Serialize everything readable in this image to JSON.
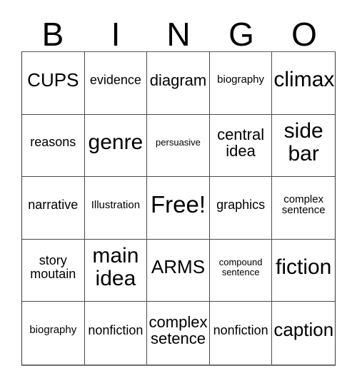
{
  "card": {
    "title": "BINGO",
    "header_letters": [
      "B",
      "I",
      "N",
      "G",
      "O"
    ],
    "columns": 5,
    "rows": 5,
    "colors": {
      "text": "#000000",
      "grid_line": "#4a4a4a",
      "background": "#ffffff"
    },
    "cells": [
      {
        "text": "CUPS",
        "size": "lg",
        "column": "B",
        "row": 1,
        "free": false
      },
      {
        "text": "evidence",
        "size": "sm",
        "column": "I",
        "row": 1,
        "free": false
      },
      {
        "text": "diagram",
        "size": "md",
        "column": "N",
        "row": 1,
        "free": false
      },
      {
        "text": "biography",
        "size": "xs",
        "column": "G",
        "row": 1,
        "free": false
      },
      {
        "text": "climax",
        "size": "xl",
        "column": "O",
        "row": 1,
        "free": false
      },
      {
        "text": "reasons",
        "size": "sm",
        "column": "B",
        "row": 2,
        "free": false
      },
      {
        "text": "genre",
        "size": "xl",
        "column": "I",
        "row": 2,
        "free": false
      },
      {
        "text": "persuasive",
        "size": "xxs",
        "column": "N",
        "row": 2,
        "free": false
      },
      {
        "text": "central\nidea",
        "size": "md",
        "column": "G",
        "row": 2,
        "free": false
      },
      {
        "text": "side\nbar",
        "size": "xl",
        "column": "O",
        "row": 2,
        "free": false
      },
      {
        "text": "narrative",
        "size": "sm",
        "column": "B",
        "row": 3,
        "free": false
      },
      {
        "text": "Illustration",
        "size": "xs",
        "column": "I",
        "row": 3,
        "free": false
      },
      {
        "text": "Free!",
        "size": "free",
        "column": "N",
        "row": 3,
        "free": true
      },
      {
        "text": "graphics",
        "size": "sm",
        "column": "G",
        "row": 3,
        "free": false
      },
      {
        "text": "complex\nsentence",
        "size": "xs",
        "column": "O",
        "row": 3,
        "free": false
      },
      {
        "text": "story\nmoutain",
        "size": "sm",
        "column": "B",
        "row": 4,
        "free": false
      },
      {
        "text": "main\nidea",
        "size": "xl",
        "column": "I",
        "row": 4,
        "free": false
      },
      {
        "text": "ARMS",
        "size": "lg",
        "column": "N",
        "row": 4,
        "free": false
      },
      {
        "text": "compound\nsentence",
        "size": "xxs",
        "column": "G",
        "row": 4,
        "free": false
      },
      {
        "text": "fiction",
        "size": "xl",
        "column": "O",
        "row": 4,
        "free": false
      },
      {
        "text": "biography",
        "size": "xs",
        "column": "B",
        "row": 5,
        "free": false
      },
      {
        "text": "nonfiction",
        "size": "sm",
        "column": "I",
        "row": 5,
        "free": false
      },
      {
        "text": "complex\nsetence",
        "size": "md",
        "column": "N",
        "row": 5,
        "free": false
      },
      {
        "text": "nonfiction",
        "size": "sm",
        "column": "G",
        "row": 5,
        "free": false
      },
      {
        "text": "caption",
        "size": "lg",
        "column": "O",
        "row": 5,
        "free": false
      }
    ]
  }
}
